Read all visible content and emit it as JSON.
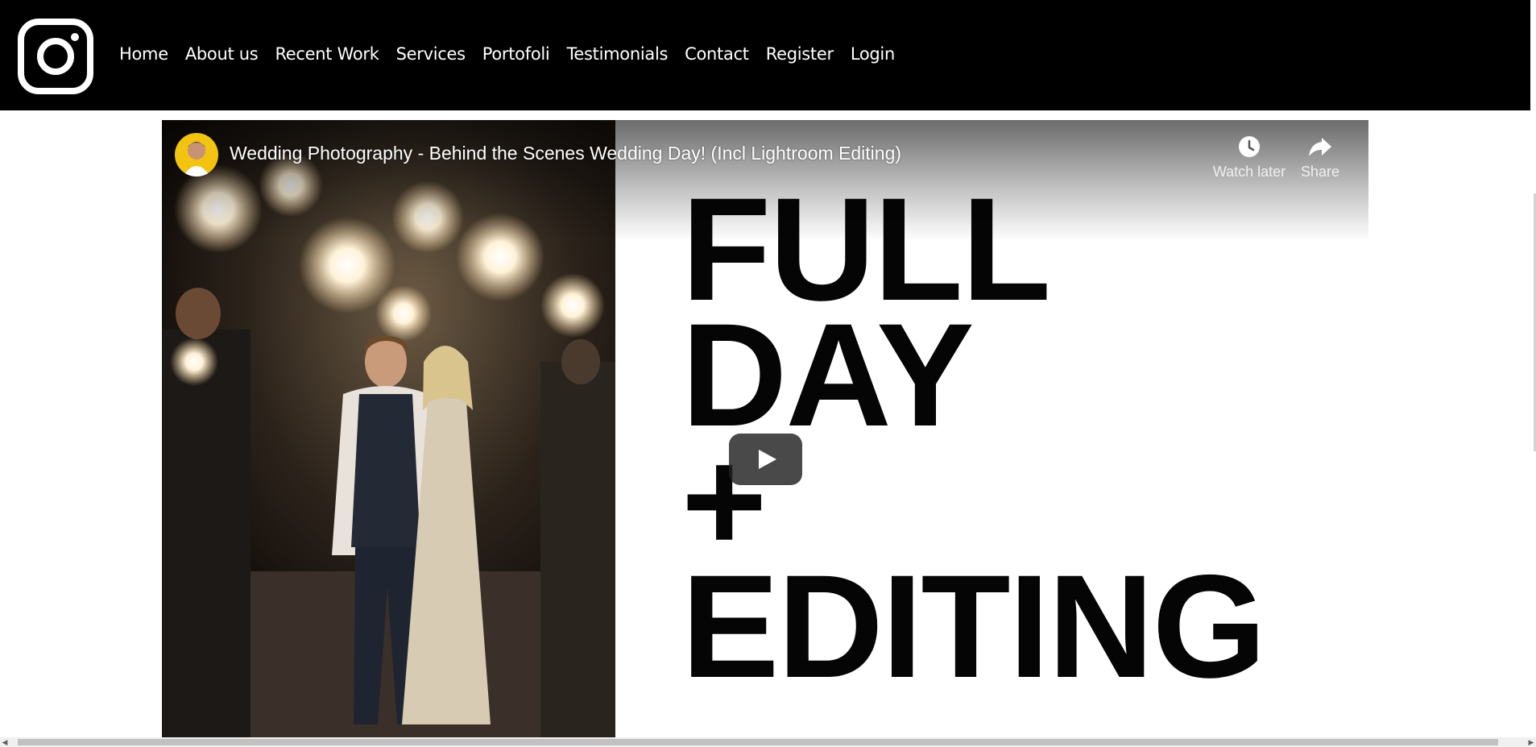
{
  "nav": {
    "items": [
      "Home",
      "About us",
      "Recent Work",
      "Services",
      "Portofoli",
      "Testimonials",
      "Contact",
      "Register",
      "Login"
    ]
  },
  "video": {
    "title": "Wedding Photography - Behind the Scenes Wedding Day! (Incl Lightroom Editing)",
    "watch_later_label": "Watch later",
    "share_label": "Share",
    "thumbnail_text": [
      "FULL",
      "DAY",
      "+",
      "EDITING"
    ]
  },
  "icons": {
    "logo": "instagram-icon",
    "watch_later": "clock-icon",
    "share": "share-arrow-icon",
    "play": "play-icon"
  },
  "colors": {
    "header_bg": "#000000",
    "nav_text": "#ffffff",
    "page_bg": "#ffffff",
    "avatar_bg": "#f2c311"
  }
}
